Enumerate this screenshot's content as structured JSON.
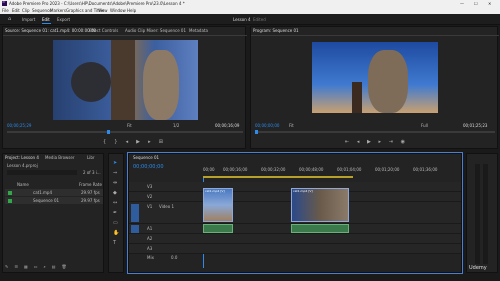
{
  "app": {
    "title": "Adobe Premiere Pro 2023 - C:\\Users\\HP\\Documents\\Adobe\\Premiere Pro\\23.0\\Lesson 4 *",
    "controls": [
      "—",
      "☐",
      "✕"
    ]
  },
  "menu": [
    "File",
    "Edit",
    "Clip",
    "Sequence",
    "Markers",
    "Graphics and Titles",
    "View",
    "Window",
    "Help"
  ],
  "workspace": {
    "home": "⌂",
    "tabs": [
      "Import",
      "Edit",
      "Export"
    ],
    "project_name": "Lesson 4",
    "project_state": "Edited"
  },
  "source_panel": {
    "tabs": [
      "Source: Sequence 01: cat1.mp4: 00:00:00:00",
      "Effect Controls",
      "Audio Clip Mixer: Sequence 01",
      "Metadata"
    ],
    "timecode": "00;00;25;29",
    "fit": "Fit",
    "ratio": "1/2",
    "duration": "00;00;16;09"
  },
  "program_panel": {
    "tab": "Program: Sequence 01",
    "timecode": "00;00;00;00",
    "fit": "Fit",
    "ratio": "Full",
    "duration": "00;01;25;23"
  },
  "project_panel": {
    "tabs": [
      "Project: Lesson 4",
      "Media Browser",
      "Libr"
    ],
    "filename": "Lesson 4.prproj",
    "count": "2 of 3 i...",
    "col_name": "Name",
    "col_rate": "Frame Rate",
    "items": [
      {
        "name": "cat1.mp4",
        "rate": "29.97 fps"
      },
      {
        "name": "Sequence 01",
        "rate": "29.97 fps"
      }
    ]
  },
  "timeline": {
    "tab": "Sequence 01",
    "timecode": "00;00;00;00",
    "ruler": [
      "00;00",
      "00;00;16;00",
      "00;00;32;00",
      "00;00;48;00",
      "00;01;04;00",
      "00;01;20;00",
      "00;01;36;00"
    ],
    "tracks_v": [
      "V3",
      "V2",
      "V1"
    ],
    "tracks_a": [
      "A1",
      "A2",
      "A3"
    ],
    "v1_label": "Video 1",
    "mix": "Mix",
    "mix_val": "0.0",
    "clip_label": "cat1.mp4 [V]"
  },
  "watermark": "Udemy"
}
